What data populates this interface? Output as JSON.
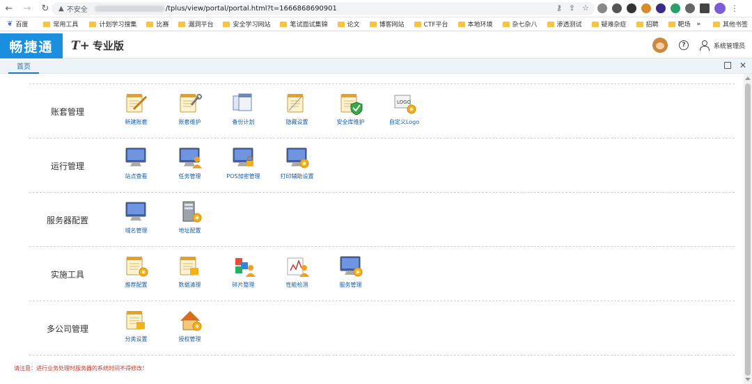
{
  "browser": {
    "insecure_label": "不安全",
    "url": "/tplus/view/portal/portal.html?t=1666868690901",
    "bookmarks": [
      "百度",
      "常用工具",
      "计划学习搜集",
      "比赛",
      "漏洞平台",
      "安全学习网站",
      "笔试面试集锦",
      "论文",
      "博客网站",
      "CTF平台",
      "本地环境",
      "杂七杂八",
      "渗透测试",
      "疑难杂症",
      "招聘",
      "靶场"
    ],
    "bookmarks_more": "»",
    "other_bookmarks": "其他书签"
  },
  "header": {
    "logo": "畅捷通",
    "edition_mark": "T+",
    "edition_name": "专业版",
    "user_name": "系统管理员"
  },
  "tabs": {
    "home": "首页"
  },
  "sections": [
    {
      "title": "账套管理",
      "items": [
        {
          "label": "新建账套",
          "icon": "new-book-icon"
        },
        {
          "label": "账套维护",
          "icon": "book-maintain-icon"
        },
        {
          "label": "备份计划",
          "icon": "backup-plan-icon"
        },
        {
          "label": "隐藏设置",
          "icon": "hide-settings-icon"
        },
        {
          "label": "安全库维护",
          "icon": "security-lib-icon"
        },
        {
          "label": "自定义Logo",
          "icon": "custom-logo-icon"
        }
      ]
    },
    {
      "title": "运行管理",
      "items": [
        {
          "label": "站点查看",
          "icon": "site-monitor-icon"
        },
        {
          "label": "任务管理",
          "icon": "task-manage-icon"
        },
        {
          "label": "POS加密管理",
          "icon": "pos-encrypt-icon"
        },
        {
          "label": "打印辅助设置",
          "icon": "print-settings-icon"
        }
      ]
    },
    {
      "title": "服务器配置",
      "items": [
        {
          "label": "域名管理",
          "icon": "domain-monitor-icon"
        },
        {
          "label": "地址配置",
          "icon": "address-config-icon"
        }
      ]
    },
    {
      "title": "实施工具",
      "items": [
        {
          "label": "推荐配置",
          "icon": "recommend-config-icon"
        },
        {
          "label": "数据清理",
          "icon": "data-clean-icon"
        },
        {
          "label": "碎片整理",
          "icon": "defrag-icon"
        },
        {
          "label": "性能检测",
          "icon": "performance-icon"
        },
        {
          "label": "服务管理",
          "icon": "service-manage-icon"
        }
      ]
    },
    {
      "title": "多公司管理",
      "items": [
        {
          "label": "分类设置",
          "icon": "category-settings-icon"
        },
        {
          "label": "授权管理",
          "icon": "license-manage-icon"
        }
      ]
    }
  ],
  "notice": "请注意：进行业务处理时服务器的系统时间不得修改！",
  "colors": {
    "brand": "#1a8fe0",
    "link": "#1a5fa8",
    "notice": "#c0392b"
  }
}
